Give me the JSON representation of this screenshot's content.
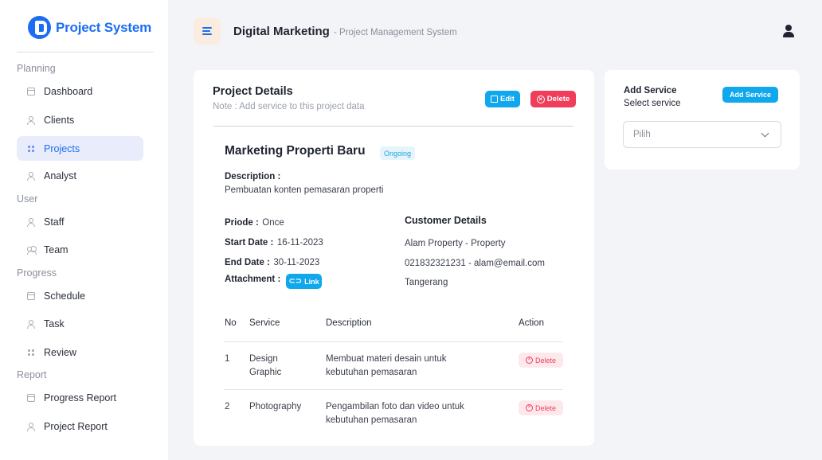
{
  "brand": {
    "name": "Project System",
    "color": "#1b6ef3"
  },
  "sidebar": {
    "sections": [
      {
        "title": "Planning"
      },
      {
        "title": "User"
      },
      {
        "title": "Progress"
      },
      {
        "title": "Report"
      }
    ],
    "items": [
      {
        "label": "Dashboard",
        "icon": "square-icon"
      },
      {
        "label": "Clients",
        "icon": "user-icon"
      },
      {
        "label": "Projects",
        "icon": "grid-icon",
        "active": true
      },
      {
        "label": "Analyst",
        "icon": "user-icon"
      },
      {
        "label": "Staff",
        "icon": "user-icon"
      },
      {
        "label": "Team",
        "icon": "users-icon"
      },
      {
        "label": "Schedule",
        "icon": "square-icon"
      },
      {
        "label": "Task",
        "icon": "user-icon"
      },
      {
        "label": "Review",
        "icon": "grid-icon"
      },
      {
        "label": "Progress Report",
        "icon": "square-icon"
      },
      {
        "label": "Project Report",
        "icon": "user-icon"
      }
    ]
  },
  "header": {
    "title": "Digital Marketing",
    "subtitle": "- Project Management System"
  },
  "project": {
    "card_title": "Project Details",
    "note": "Note : Add service to this project data",
    "edit_label": "Edit",
    "delete_label": "Delete",
    "name": "Marketing Properti Baru",
    "status": "Ongoing",
    "description_label": "Description :",
    "description": "Pembuatan konten pemasaran properti",
    "period_label": "Priode :",
    "period": "Once",
    "start_label": "Start Date :",
    "start": "16-11-2023",
    "end_label": "End Date :",
    "end": "30-11-2023",
    "attachment_label": "Attachment :",
    "link_label": "Link"
  },
  "customer": {
    "title": "Customer Details",
    "company": "Alam Property - Property",
    "contact": "021832321231 - alam@email.com",
    "city": "Tangerang"
  },
  "services_table": {
    "headers": {
      "no": "No",
      "service": "Service",
      "description": "Description",
      "action": "Action"
    },
    "rows": [
      {
        "no": "1",
        "service_line1": "Design",
        "service_line2": "Graphic",
        "desc_line1": "Membuat materi desain untuk",
        "desc_line2": "kebutuhan pemasaran",
        "action": "Delete"
      },
      {
        "no": "2",
        "service_line1": "Photography",
        "service_line2": "",
        "desc_line1": "Pengambilan foto dan video untuk",
        "desc_line2": "kebutuhan pemasaran",
        "action": "Delete"
      }
    ]
  },
  "add_service": {
    "title": "Add Service",
    "subtitle": "Select service",
    "button_label": "Add Service",
    "select_value": "Pilih"
  },
  "colors": {
    "accent": "#0fa8ec",
    "danger": "#ef3d5b",
    "primary": "#1b6ef3"
  }
}
